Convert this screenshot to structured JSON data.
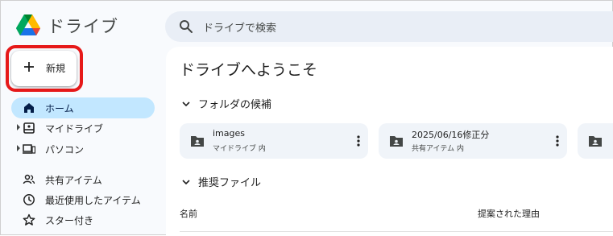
{
  "app": {
    "title": "ドライブ"
  },
  "search": {
    "placeholder": "ドライブで検索"
  },
  "new_button": {
    "label": "新規"
  },
  "sidebar": {
    "items": [
      {
        "label": "ホーム",
        "icon": "home-icon",
        "active": true
      },
      {
        "label": "マイドライブ",
        "icon": "my-drive-icon",
        "expandable": true
      },
      {
        "label": "パソコン",
        "icon": "computer-icon",
        "expandable": true
      },
      {
        "label": "共有アイテム",
        "icon": "shared-icon"
      },
      {
        "label": "最近使用したアイテム",
        "icon": "clock-icon"
      },
      {
        "label": "スター付き",
        "icon": "star-icon"
      }
    ]
  },
  "main": {
    "welcome": "ドライブへようこそ",
    "folders_section": "フォルダの候補",
    "folders": [
      {
        "name": "images",
        "location": "マイドライブ 内"
      },
      {
        "name": "2025/06/16修正分",
        "location": "共有アイテム 内"
      }
    ],
    "files_section": "推奨ファイル",
    "table": {
      "col_name": "名前",
      "col_reason": "提案された理由"
    }
  },
  "colors": {
    "accent": "#c2e7ff",
    "highlight_border": "#e61919",
    "search_bg": "#e9eef6",
    "card_bg": "#f0f4f9"
  }
}
